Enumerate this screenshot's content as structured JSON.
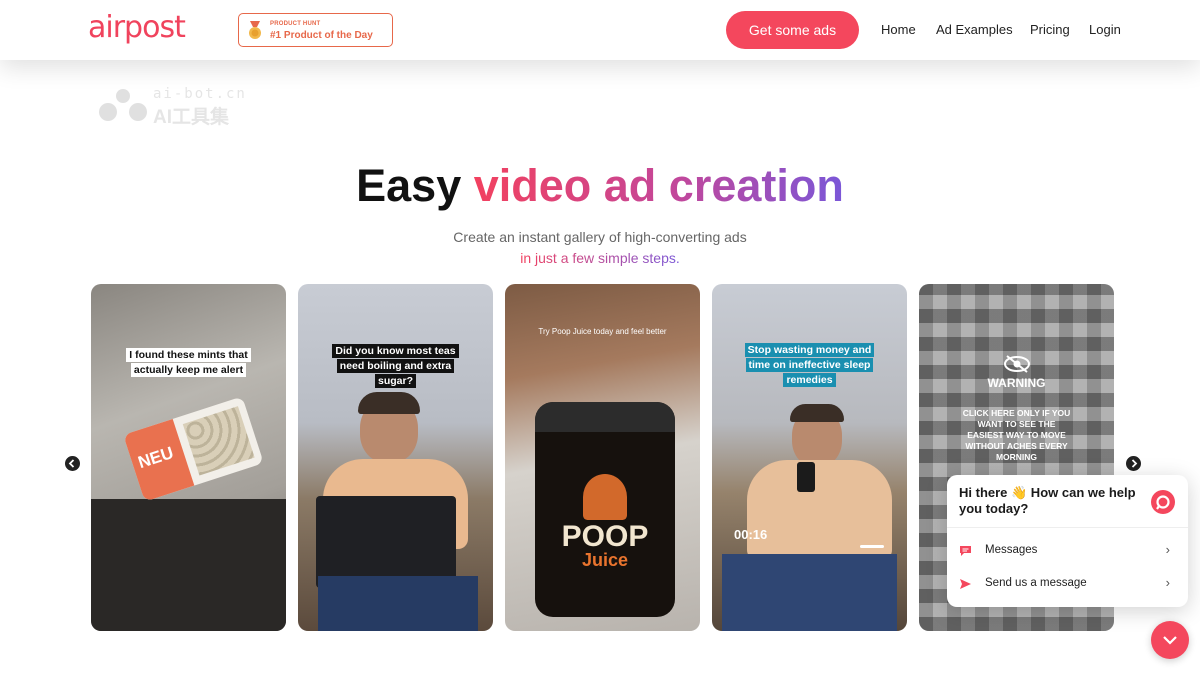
{
  "header": {
    "logo": "airpost",
    "badge_small": "PRODUCT HUNT",
    "badge_big": "#1 Product of the Day",
    "cta": "Get some ads",
    "nav": [
      "Home",
      "Ad Examples",
      "Pricing",
      "Login"
    ]
  },
  "watermark": {
    "top": "ai-bot.cn",
    "bottom": "AI工具集"
  },
  "hero": {
    "title_plain": "Easy ",
    "title_gradient": "video ad creation",
    "subtitle_line1": "Create an instant gallery of high-converting ads",
    "subtitle_line2": "in just a few simple steps."
  },
  "cards": [
    {
      "caption": "I found these mints that actually keep me alert",
      "product": "NEU"
    },
    {
      "caption": "Did you know most teas need boiling and extra sugar?"
    },
    {
      "caption": "Try Poop Juice today and feel better",
      "product_line1": "POOP",
      "product_line2": "Juice"
    },
    {
      "caption": "Stop wasting money and time on ineffective sleep remedies",
      "time": "00:16"
    },
    {
      "warning": "WARNING",
      "body": "CLICK HERE ONLY IF YOU WANT TO SEE THE EASIEST WAY TO MOVE WITHOUT ACHES EVERY MORNING"
    }
  ],
  "chat": {
    "greeting": "Hi there 👋 How can we help you today?",
    "items": [
      {
        "label": "Messages",
        "icon": "message-icon"
      },
      {
        "label": "Send us a message",
        "icon": "send-icon"
      }
    ]
  },
  "colors": {
    "brand": "#f4475d",
    "gradient_start": "#f2415f",
    "gradient_end": "#7a57d8"
  }
}
